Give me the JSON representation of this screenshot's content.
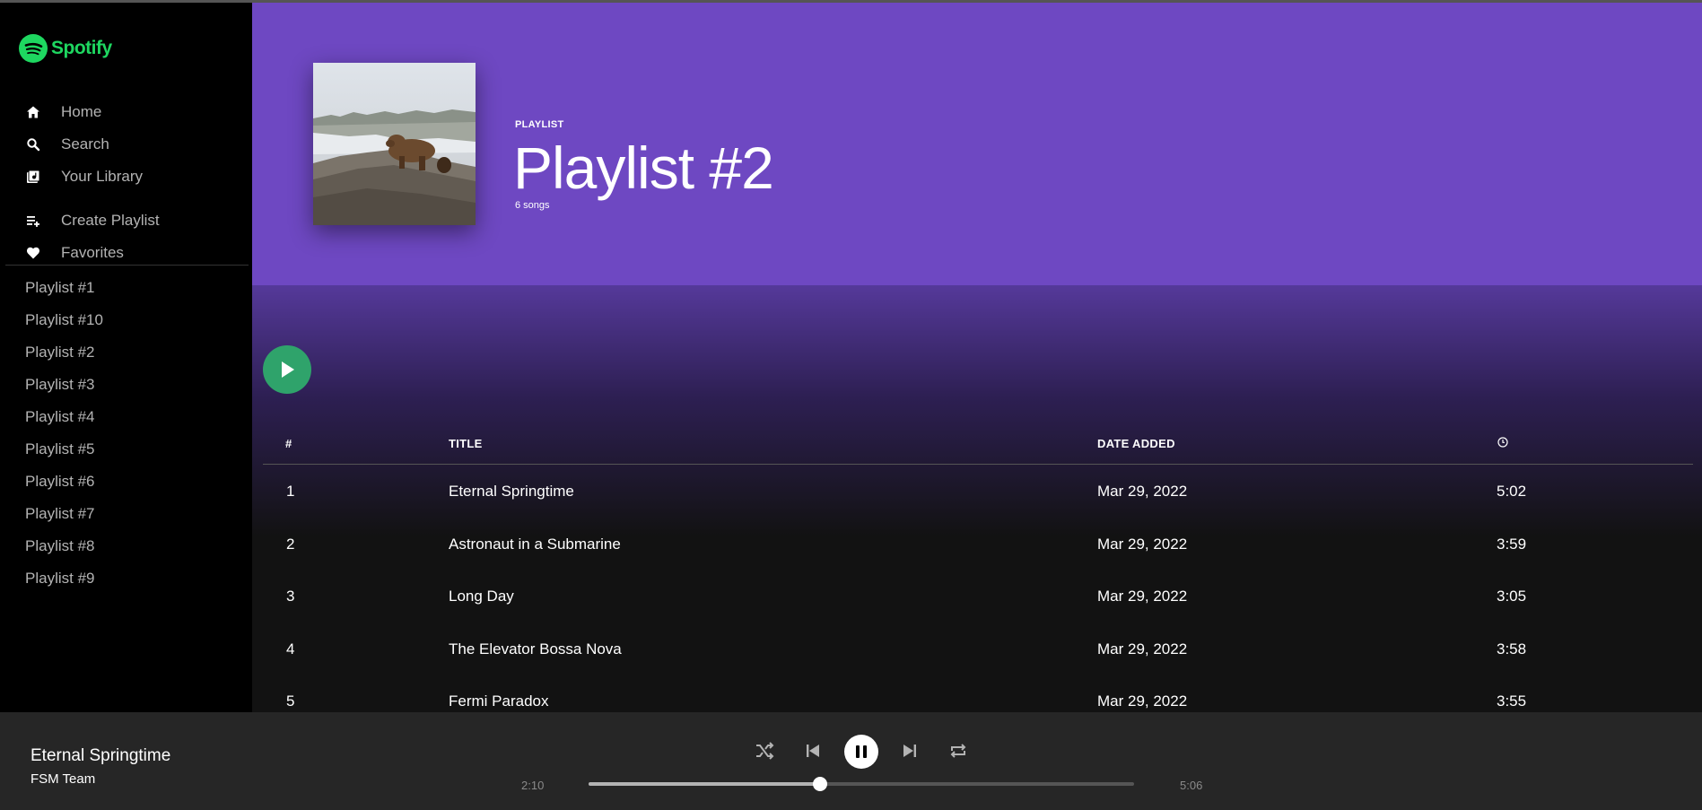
{
  "brand": {
    "name": "Spotify",
    "color": "#1ed760"
  },
  "sidebar": {
    "nav": [
      {
        "label": "Home",
        "icon": "home-icon"
      },
      {
        "label": "Search",
        "icon": "search-icon"
      },
      {
        "label": "Your Library",
        "icon": "library-icon"
      }
    ],
    "actions": [
      {
        "label": "Create Playlist",
        "icon": "add-playlist-icon"
      },
      {
        "label": "Favorites",
        "icon": "heart-icon"
      }
    ],
    "playlists": [
      "Playlist #1",
      "Playlist #10",
      "Playlist #2",
      "Playlist #3",
      "Playlist #4",
      "Playlist #5",
      "Playlist #6",
      "Playlist #7",
      "Playlist #8",
      "Playlist #9"
    ]
  },
  "playlist": {
    "type_label": "PLAYLIST",
    "title": "Playlist #2",
    "song_count": "6 songs",
    "accent": "#6e48c2"
  },
  "table": {
    "headers": {
      "number": "#",
      "title": "TITLE",
      "date_added": "DATE ADDED",
      "duration_icon": "clock-icon"
    },
    "rows": [
      {
        "num": "1",
        "title": "Eternal Springtime",
        "date": "Mar 29, 2022",
        "duration": "5:02"
      },
      {
        "num": "2",
        "title": "Astronaut in a Submarine",
        "date": "Mar 29, 2022",
        "duration": "3:59"
      },
      {
        "num": "3",
        "title": "Long Day",
        "date": "Mar 29, 2022",
        "duration": "3:05"
      },
      {
        "num": "4",
        "title": "The Elevator Bossa Nova",
        "date": "Mar 29, 2022",
        "duration": "3:58"
      },
      {
        "num": "5",
        "title": "Fermi Paradox",
        "date": "Mar 29, 2022",
        "duration": "3:55"
      }
    ]
  },
  "player": {
    "track_title": "Eternal Springtime",
    "artist": "FSM Team",
    "elapsed": "2:10",
    "total": "5:06",
    "progress": 0.425,
    "state": "playing"
  }
}
